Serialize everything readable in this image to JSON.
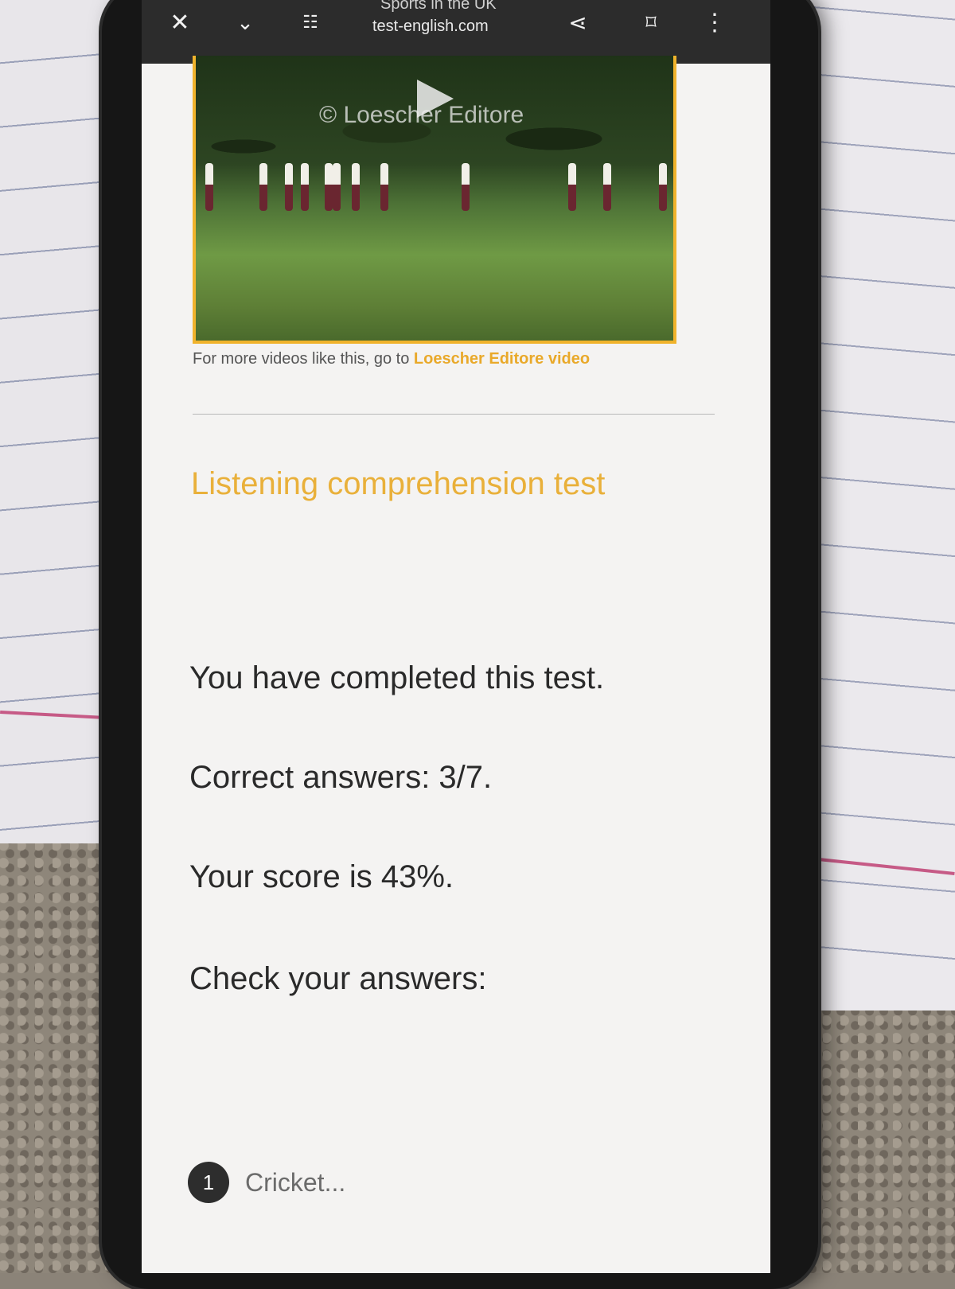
{
  "browser": {
    "page_title_partial": "Sports in the UK",
    "url": "test-english.com",
    "icons": {
      "close": "close-icon",
      "dropdown": "chevron-down-icon",
      "settings": "tune-icon",
      "share": "share-icon",
      "bookmark": "bookmark-icon",
      "menu": "more-vert-icon"
    }
  },
  "video": {
    "watermark": "© Loescher Editore",
    "note_prefix": "For more videos like this, go to ",
    "note_link": "Loescher Editore video"
  },
  "test": {
    "title": "Listening comprehension test",
    "completed": "You have completed this test.",
    "correct_answers": "Correct answers: 3/7.",
    "score": "Your score is 43%.",
    "check_answers": "Check your answers:",
    "answers": [
      {
        "number": "1",
        "text": "Cricket..."
      }
    ]
  },
  "colors": {
    "accent": "#e9b03a",
    "toolbar": "#2c2c2c",
    "badge": "#2d2d2d"
  }
}
